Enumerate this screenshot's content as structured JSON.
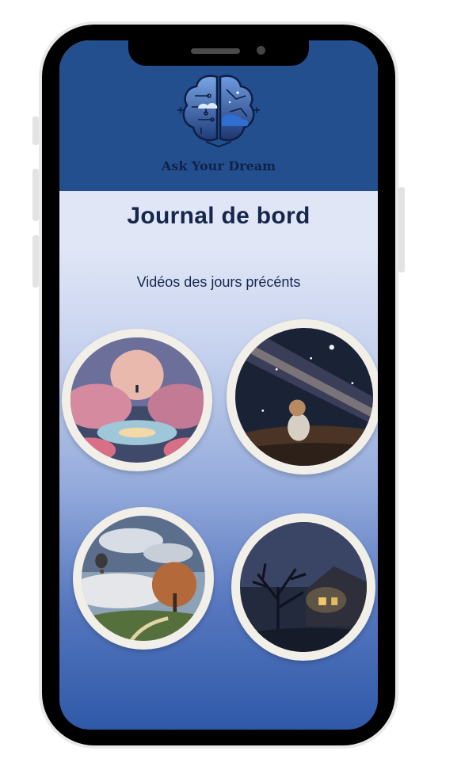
{
  "app": {
    "brand_name": "Ask Your Dream"
  },
  "page": {
    "title": "Journal de bord",
    "subtitle": "Vidéos des jours précénts"
  },
  "videos": [
    {
      "icon": "dreamscape-moon-lake-thumbnail"
    },
    {
      "icon": "milky-way-girl-thumbnail"
    },
    {
      "icon": "hot-air-balloon-clouds-thumbnail"
    },
    {
      "icon": "night-house-tree-thumbnail"
    }
  ],
  "colors": {
    "header": "#234f8f",
    "text_dark": "#16264c",
    "frame": "#000000",
    "thumb_border": "#f1efe8"
  }
}
